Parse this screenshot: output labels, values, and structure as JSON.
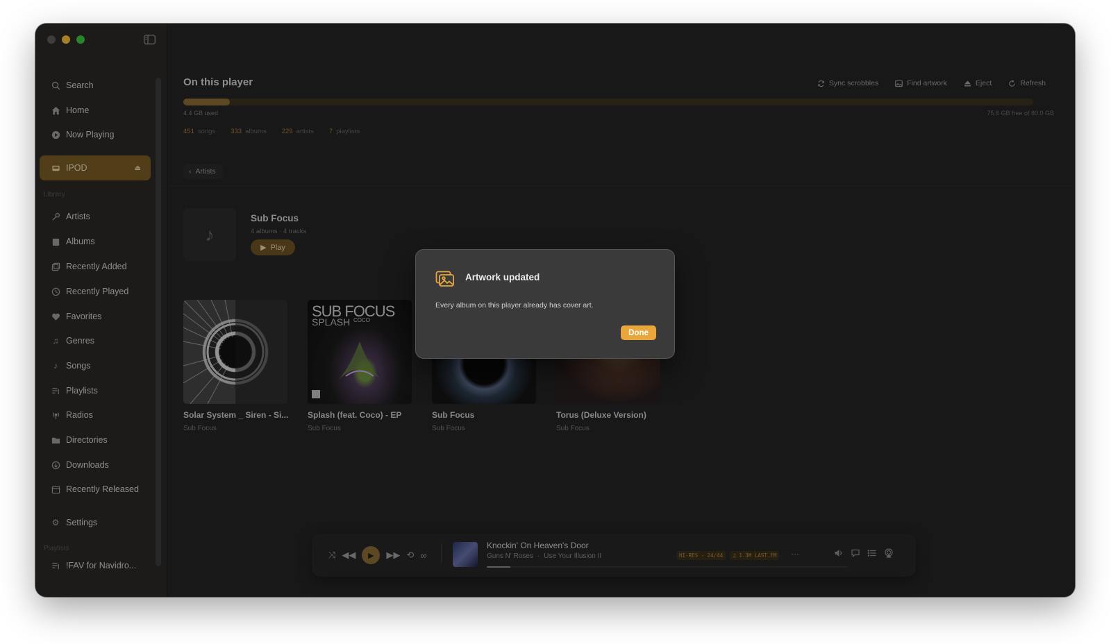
{
  "sidebar": {
    "nav_top": [
      {
        "label": "Search",
        "icon": "search-icon"
      },
      {
        "label": "Home",
        "icon": "home-icon"
      },
      {
        "label": "Now Playing",
        "icon": "play-circle-icon"
      }
    ],
    "device": {
      "label": "IPOD",
      "icon": "ipod-icon"
    },
    "library_label": "Library",
    "library": [
      {
        "label": "Artists",
        "icon": "microphone-icon"
      },
      {
        "label": "Albums",
        "icon": "album-icon"
      },
      {
        "label": "Recently Added",
        "icon": "recently-added-icon"
      },
      {
        "label": "Recently Played",
        "icon": "history-icon"
      },
      {
        "label": "Favorites",
        "icon": "heart-icon"
      },
      {
        "label": "Genres",
        "icon": "genres-icon"
      },
      {
        "label": "Songs",
        "icon": "music-note-icon"
      },
      {
        "label": "Playlists",
        "icon": "playlist-icon"
      },
      {
        "label": "Radios",
        "icon": "radio-icon"
      },
      {
        "label": "Directories",
        "icon": "folder-icon"
      },
      {
        "label": "Downloads",
        "icon": "download-icon"
      },
      {
        "label": "Recently Released",
        "icon": "calendar-icon"
      }
    ],
    "settings": {
      "label": "Settings",
      "icon": "gear-icon"
    },
    "playlists_label": "Playlists",
    "playlists": [
      {
        "label": "!FAV for Navidro...",
        "icon": "playlist-icon"
      }
    ]
  },
  "main": {
    "title": "On this player",
    "toolbar": {
      "sync_scrobbles": "Sync scrobbles",
      "find_artwork": "Find artwork",
      "eject": "Eject",
      "refresh": "Refresh"
    },
    "storage": {
      "used_label": "4.4 GB used",
      "free_label": "75.6 GB free of 80.0 GB",
      "used_fraction": 0.055
    },
    "stats": [
      {
        "value": "451",
        "label": "songs"
      },
      {
        "value": "333",
        "label": "albums"
      },
      {
        "value": "229",
        "label": "artists"
      },
      {
        "value": "7",
        "label": "playlists"
      }
    ],
    "back_label": "Artists",
    "artist": {
      "name": "Sub Focus",
      "meta": "4 albums · 4 tracks",
      "play_label": "Play"
    },
    "albums": [
      {
        "title": "Solar System _ Siren - Si...",
        "artist": "Sub Focus"
      },
      {
        "title": "Splash (feat. Coco) - EP",
        "artist": "Sub Focus"
      },
      {
        "title": "Sub Focus",
        "artist": "Sub Focus"
      },
      {
        "title": "Torus (Deluxe Version)",
        "artist": "Sub Focus"
      }
    ],
    "album_art_text": {
      "splash_line1": "SUB FOCUS",
      "splash_line2": "SPLASH",
      "splash_feat": "COCO"
    }
  },
  "player": {
    "title": "Knockin' On Heaven's Door",
    "artist": "Guns N' Roses",
    "separator": "·",
    "album": "Use Your Illusion II",
    "badges": [
      "HI-RES · 24/44",
      "♫ 1.3M LAST.FM"
    ],
    "progress_fraction": 0.065,
    "more": "···"
  },
  "dialog": {
    "title": "Artwork updated",
    "message": "Every album on this player already has cover art.",
    "done_label": "Done",
    "icon": "artwork-icon"
  },
  "colors": {
    "accent": "#e8a63c",
    "accent_dim": "#7a5a26",
    "window_bg": "#242424",
    "sidebar_bg": "#2a2926"
  }
}
